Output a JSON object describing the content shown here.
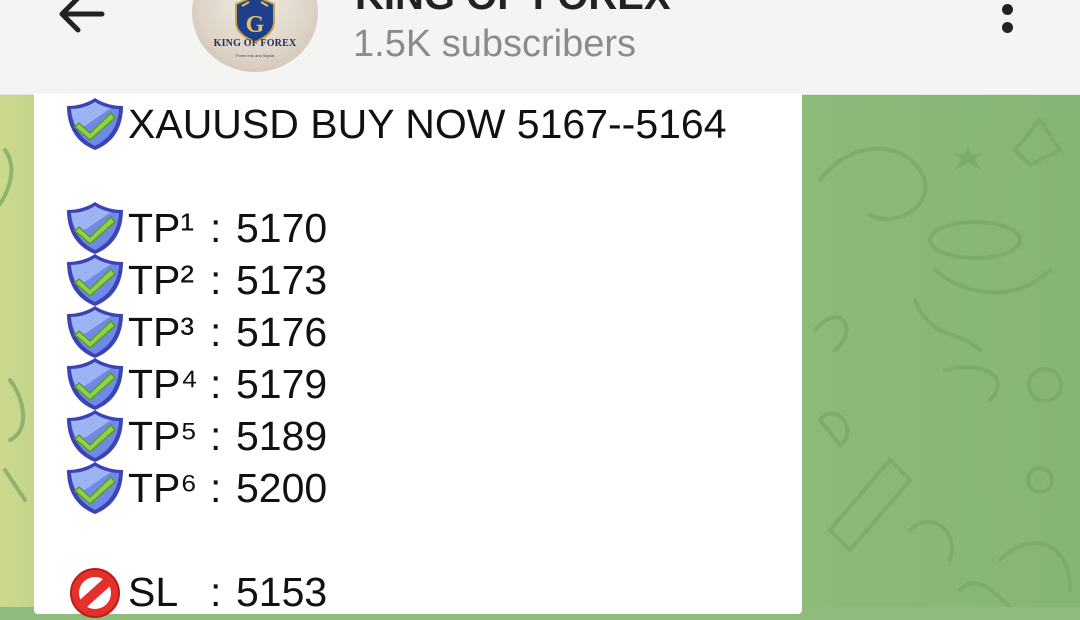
{
  "header": {
    "channel_name": "KING OF FOREX",
    "subscribers": "1.5K subscribers",
    "avatar_text": "KING OF FOREX",
    "avatar_subtext": "Forex Info and Signal",
    "back_icon": "arrow-left-icon",
    "menu_icon": "more-vertical-icon"
  },
  "message": {
    "headline": "XAUUSD BUY NOW 5167--5164",
    "targets": [
      {
        "label": "TP¹",
        "sep": ":",
        "value": "5170"
      },
      {
        "label": "TP²",
        "sep": ":",
        "value": "5173"
      },
      {
        "label": "TP³",
        "sep": ":",
        "value": "5176"
      },
      {
        "label": "TP⁴",
        "sep": ":",
        "value": "5179"
      },
      {
        "label": "TP⁵",
        "sep": ":",
        "value": "5189"
      },
      {
        "label": "TP⁶",
        "sep": ":",
        "value": "5200"
      }
    ],
    "stop_loss": {
      "label": "SL",
      "sep": ":",
      "value": "5153"
    },
    "shield_icon": "shield-check-emoji",
    "stop_icon": "prohibited-emoji"
  },
  "colors": {
    "header_bg": "#f4f5f2",
    "wallpaper": "#8fbb7c",
    "bubble": "#ffffff",
    "shield_blue": "#4a56c9",
    "check_green": "#8fd14f",
    "stop_red": "#e5312b"
  }
}
